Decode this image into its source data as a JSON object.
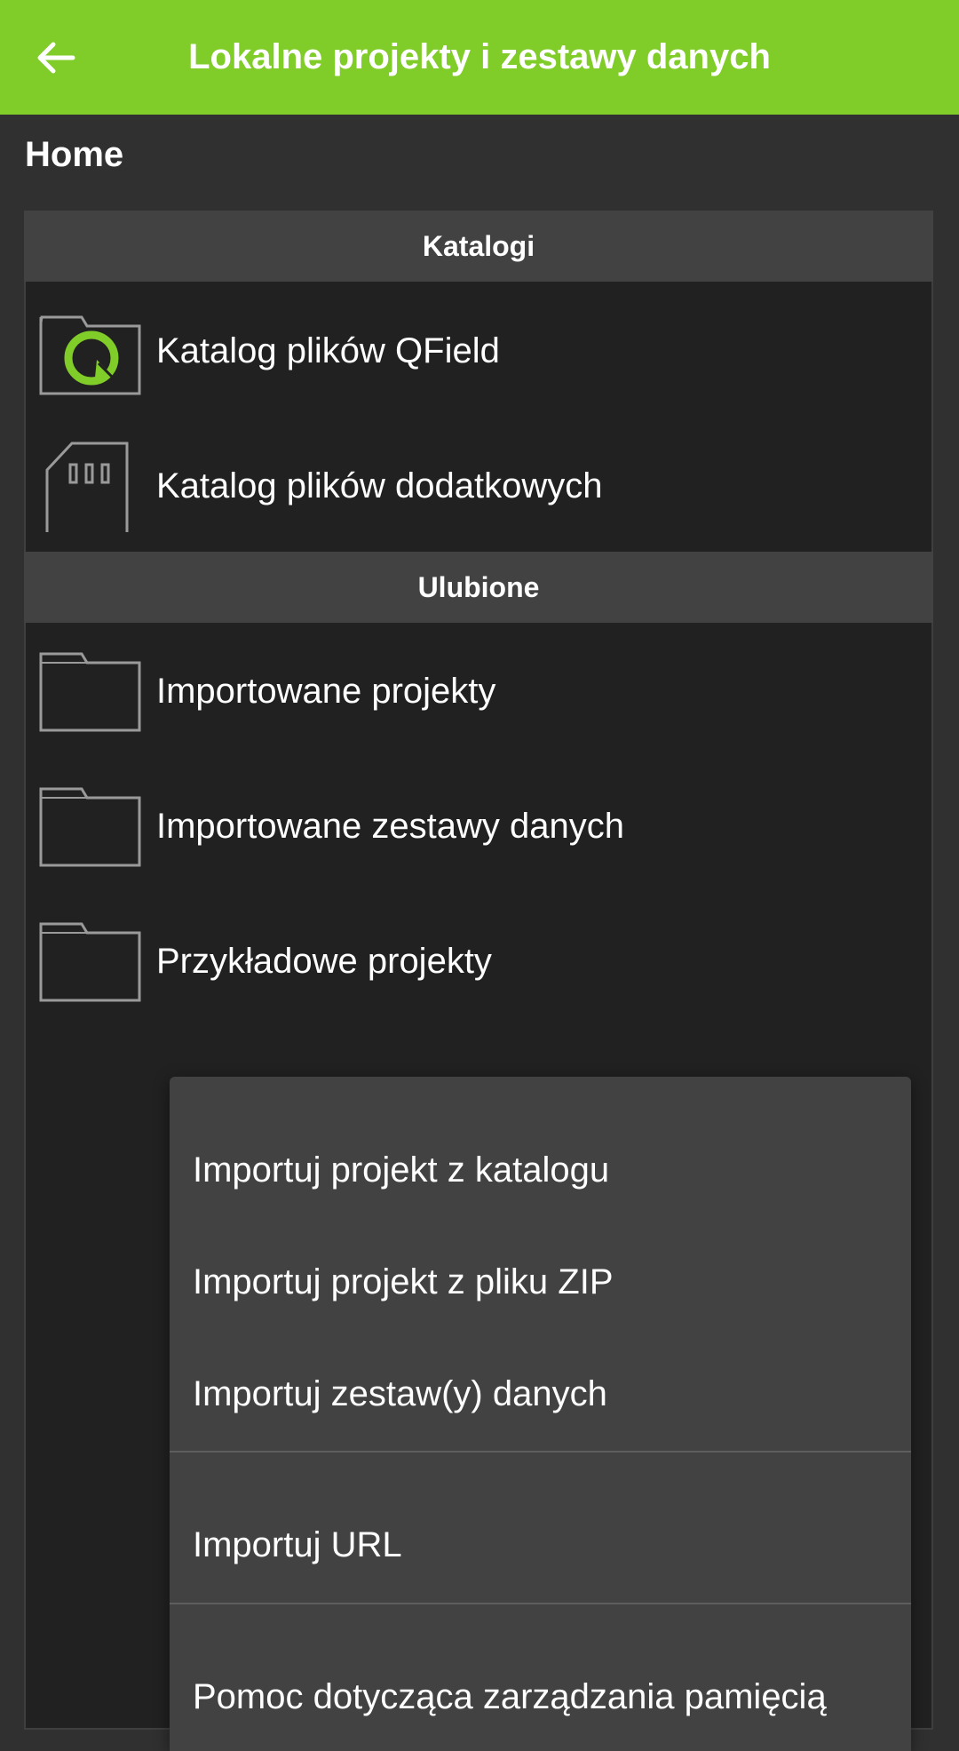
{
  "app_bar": {
    "title": "Lokalne projekty i zestawy danych",
    "back_icon": "arrow-left-icon"
  },
  "breadcrumb": "Home",
  "sections": {
    "catalogs": {
      "header": "Katalogi",
      "items": [
        {
          "label": "Katalog plików QField",
          "icon": "qfield-folder-icon"
        },
        {
          "label": "Katalog plików dodatkowych",
          "icon": "sd-card-icon"
        }
      ]
    },
    "favorites": {
      "header": "Ulubione",
      "items": [
        {
          "label": "Importowane projekty",
          "icon": "folder-icon"
        },
        {
          "label": "Importowane zestawy danych",
          "icon": "folder-icon"
        },
        {
          "label": "Przykładowe projekty",
          "icon": "folder-icon"
        }
      ]
    }
  },
  "menu": {
    "items": [
      {
        "label": "Importuj projekt z katalogu"
      },
      {
        "label": "Importuj projekt z pliku ZIP"
      },
      {
        "label": "Importuj zestaw(y) danych"
      },
      {
        "label": "Importuj URL"
      },
      {
        "label": "Pomoc dotycząca zarządzania pamięcią"
      }
    ]
  },
  "colors": {
    "accent": "#80cc28",
    "background": "#303030",
    "panel": "#212121",
    "section_header": "#424242",
    "menu": "#424242"
  }
}
